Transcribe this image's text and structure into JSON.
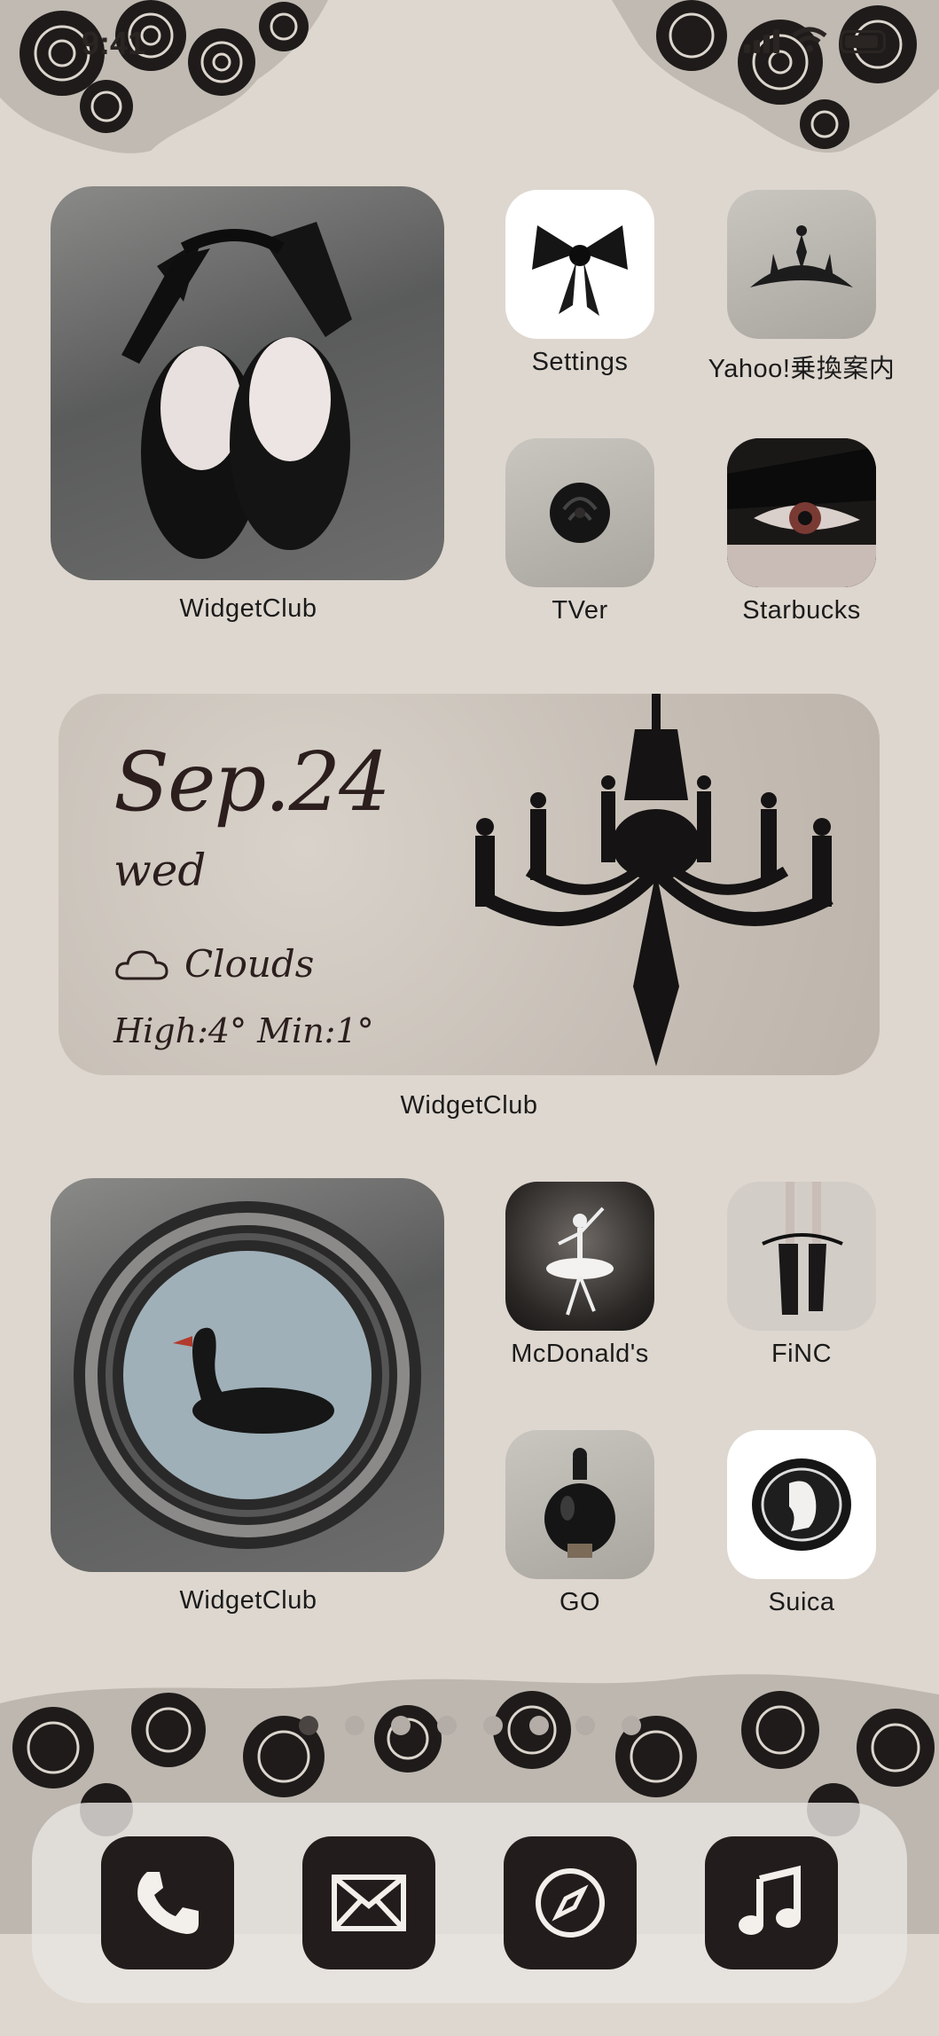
{
  "status_bar": {
    "time": "9:41"
  },
  "widgets": {
    "top_left": {
      "label": "WidgetClub",
      "image": "black-ballet-flats"
    },
    "middle": {
      "label": "WidgetClub",
      "date": "Sep.24",
      "day": "wed",
      "weather": "Clouds",
      "temp": "High:4° Min:1°",
      "image": "black-chandelier"
    },
    "bottom_left": {
      "label": "WidgetClub",
      "image": "black-swan-ornate-mirror"
    }
  },
  "apps": [
    {
      "label": "Settings",
      "icon": "black-lace-bow-icon"
    },
    {
      "label": "Yahoo!乗換案内",
      "icon": "tiara-icon"
    },
    {
      "label": "TVer",
      "icon": "black-rose-icon"
    },
    {
      "label": "Starbucks",
      "icon": "feathered-eye-icon"
    },
    {
      "label": "McDonald's",
      "icon": "ballerina-icon"
    },
    {
      "label": "FiNC",
      "icon": "pointe-shoes-icon"
    },
    {
      "label": "GO",
      "icon": "perfume-bottle-icon"
    },
    {
      "label": "Suica",
      "icon": "cameo-icon"
    }
  ],
  "page_dots": {
    "count": 8,
    "active": 0
  },
  "dock": [
    {
      "name": "phone-icon"
    },
    {
      "name": "mail-icon"
    },
    {
      "name": "compass-icon"
    },
    {
      "name": "music-icon"
    }
  ],
  "colors": {
    "background": "#ded7cf",
    "dock_icon": "#231c1c",
    "text": "#1b1b1b"
  }
}
